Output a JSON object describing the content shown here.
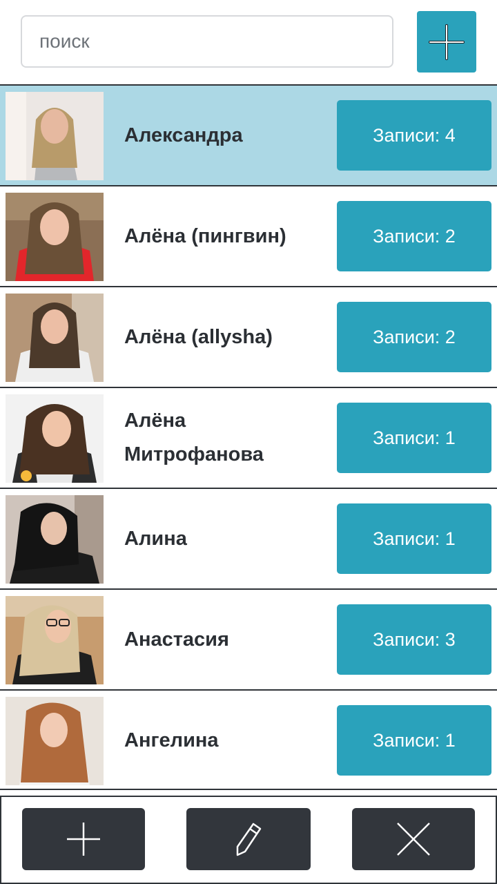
{
  "search": {
    "placeholder": "поиск",
    "value": ""
  },
  "header": {
    "add_icon": "plus-icon"
  },
  "contacts": [
    {
      "name": "Александра",
      "records": "Записи: 4",
      "selected": true
    },
    {
      "name": "Алёна (пингвин)",
      "records": "Записи: 2",
      "selected": false
    },
    {
      "name": "Алёна (allysha)",
      "records": "Записи: 2",
      "selected": false
    },
    {
      "name": "Алёна Митрофанова",
      "records": "Записи: 1",
      "selected": false
    },
    {
      "name": "Алина",
      "records": "Записи: 1",
      "selected": false
    },
    {
      "name": "Анастасия",
      "records": "Записи: 3",
      "selected": false
    },
    {
      "name": "Ангелина",
      "records": "Записи: 1",
      "selected": false
    }
  ],
  "toolbar": {
    "add_icon": "plus-icon",
    "edit_icon": "pencil-icon",
    "delete_icon": "close-icon"
  },
  "colors": {
    "accent": "#2aa2bb",
    "selected_row": "#acd8e5",
    "toolbar_button": "#32363c",
    "text": "#2b2f34"
  }
}
